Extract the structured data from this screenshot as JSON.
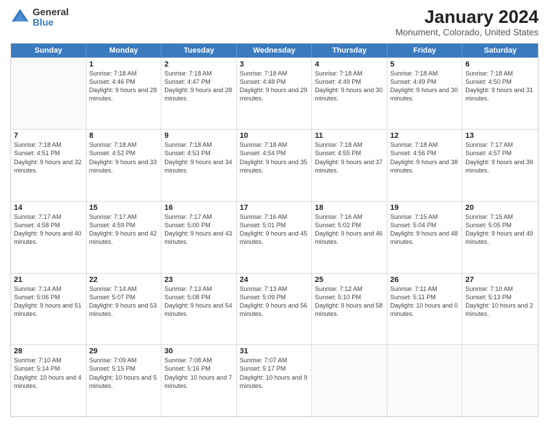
{
  "logo": {
    "line1": "General",
    "line2": "Blue"
  },
  "title": "January 2024",
  "subtitle": "Monument, Colorado, United States",
  "header_days": [
    "Sunday",
    "Monday",
    "Tuesday",
    "Wednesday",
    "Thursday",
    "Friday",
    "Saturday"
  ],
  "rows": [
    [
      {
        "day": "",
        "sunrise": "",
        "sunset": "",
        "daylight": ""
      },
      {
        "day": "1",
        "sunrise": "7:18 AM",
        "sunset": "4:46 PM",
        "daylight": "9 hours and 28 minutes."
      },
      {
        "day": "2",
        "sunrise": "7:18 AM",
        "sunset": "4:47 PM",
        "daylight": "9 hours and 28 minutes."
      },
      {
        "day": "3",
        "sunrise": "7:18 AM",
        "sunset": "4:48 PM",
        "daylight": "9 hours and 29 minutes."
      },
      {
        "day": "4",
        "sunrise": "7:18 AM",
        "sunset": "4:49 PM",
        "daylight": "9 hours and 30 minutes."
      },
      {
        "day": "5",
        "sunrise": "7:18 AM",
        "sunset": "4:49 PM",
        "daylight": "9 hours and 30 minutes."
      },
      {
        "day": "6",
        "sunrise": "7:18 AM",
        "sunset": "4:50 PM",
        "daylight": "9 hours and 31 minutes."
      }
    ],
    [
      {
        "day": "7",
        "sunrise": "7:18 AM",
        "sunset": "4:51 PM",
        "daylight": "9 hours and 32 minutes."
      },
      {
        "day": "8",
        "sunrise": "7:18 AM",
        "sunset": "4:52 PM",
        "daylight": "9 hours and 33 minutes."
      },
      {
        "day": "9",
        "sunrise": "7:18 AM",
        "sunset": "4:53 PM",
        "daylight": "9 hours and 34 minutes."
      },
      {
        "day": "10",
        "sunrise": "7:18 AM",
        "sunset": "4:54 PM",
        "daylight": "9 hours and 35 minutes."
      },
      {
        "day": "11",
        "sunrise": "7:18 AM",
        "sunset": "4:55 PM",
        "daylight": "9 hours and 37 minutes."
      },
      {
        "day": "12",
        "sunrise": "7:18 AM",
        "sunset": "4:56 PM",
        "daylight": "9 hours and 38 minutes."
      },
      {
        "day": "13",
        "sunrise": "7:17 AM",
        "sunset": "4:57 PM",
        "daylight": "9 hours and 39 minutes."
      }
    ],
    [
      {
        "day": "14",
        "sunrise": "7:17 AM",
        "sunset": "4:58 PM",
        "daylight": "9 hours and 40 minutes."
      },
      {
        "day": "15",
        "sunrise": "7:17 AM",
        "sunset": "4:59 PM",
        "daylight": "9 hours and 42 minutes."
      },
      {
        "day": "16",
        "sunrise": "7:17 AM",
        "sunset": "5:00 PM",
        "daylight": "9 hours and 43 minutes."
      },
      {
        "day": "17",
        "sunrise": "7:16 AM",
        "sunset": "5:01 PM",
        "daylight": "9 hours and 45 minutes."
      },
      {
        "day": "18",
        "sunrise": "7:16 AM",
        "sunset": "5:02 PM",
        "daylight": "9 hours and 46 minutes."
      },
      {
        "day": "19",
        "sunrise": "7:15 AM",
        "sunset": "5:04 PM",
        "daylight": "9 hours and 48 minutes."
      },
      {
        "day": "20",
        "sunrise": "7:15 AM",
        "sunset": "5:05 PM",
        "daylight": "9 hours and 49 minutes."
      }
    ],
    [
      {
        "day": "21",
        "sunrise": "7:14 AM",
        "sunset": "5:06 PM",
        "daylight": "9 hours and 51 minutes."
      },
      {
        "day": "22",
        "sunrise": "7:14 AM",
        "sunset": "5:07 PM",
        "daylight": "9 hours and 53 minutes."
      },
      {
        "day": "23",
        "sunrise": "7:13 AM",
        "sunset": "5:08 PM",
        "daylight": "9 hours and 54 minutes."
      },
      {
        "day": "24",
        "sunrise": "7:13 AM",
        "sunset": "5:09 PM",
        "daylight": "9 hours and 56 minutes."
      },
      {
        "day": "25",
        "sunrise": "7:12 AM",
        "sunset": "5:10 PM",
        "daylight": "9 hours and 58 minutes."
      },
      {
        "day": "26",
        "sunrise": "7:11 AM",
        "sunset": "5:11 PM",
        "daylight": "10 hours and 0 minutes."
      },
      {
        "day": "27",
        "sunrise": "7:10 AM",
        "sunset": "5:13 PM",
        "daylight": "10 hours and 2 minutes."
      }
    ],
    [
      {
        "day": "28",
        "sunrise": "7:10 AM",
        "sunset": "5:14 PM",
        "daylight": "10 hours and 4 minutes."
      },
      {
        "day": "29",
        "sunrise": "7:09 AM",
        "sunset": "5:15 PM",
        "daylight": "10 hours and 5 minutes."
      },
      {
        "day": "30",
        "sunrise": "7:08 AM",
        "sunset": "5:16 PM",
        "daylight": "10 hours and 7 minutes."
      },
      {
        "day": "31",
        "sunrise": "7:07 AM",
        "sunset": "5:17 PM",
        "daylight": "10 hours and 9 minutes."
      },
      {
        "day": "",
        "sunrise": "",
        "sunset": "",
        "daylight": ""
      },
      {
        "day": "",
        "sunrise": "",
        "sunset": "",
        "daylight": ""
      },
      {
        "day": "",
        "sunrise": "",
        "sunset": "",
        "daylight": ""
      }
    ]
  ]
}
